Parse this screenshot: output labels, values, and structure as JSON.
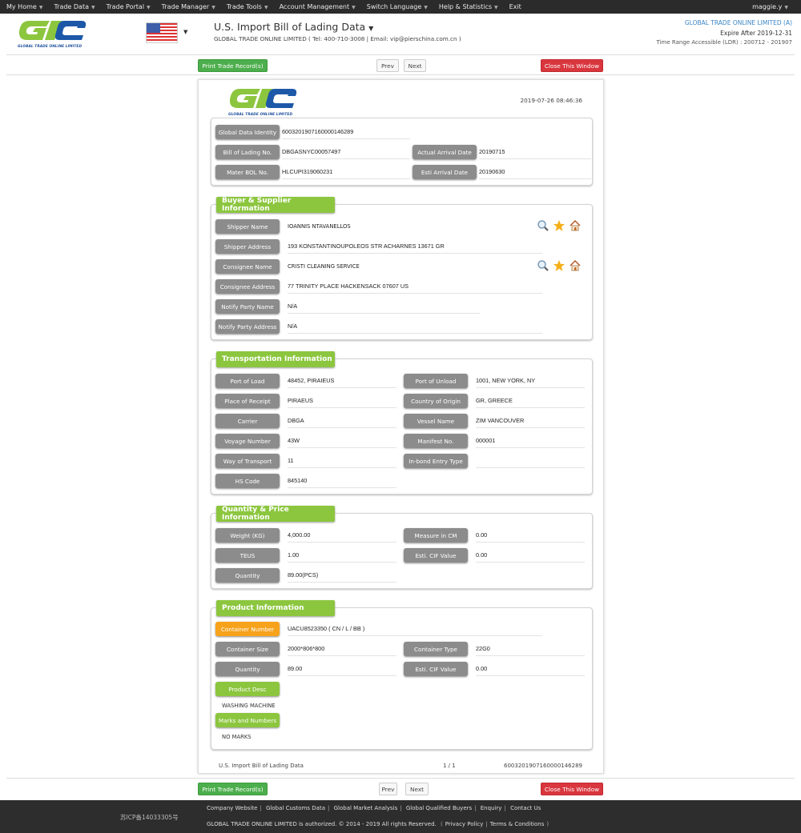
{
  "nav": {
    "items": [
      {
        "label": "My Home"
      },
      {
        "label": "Trade Data"
      },
      {
        "label": "Trade Portal"
      },
      {
        "label": "Trade Manager"
      },
      {
        "label": "Trade Tools"
      },
      {
        "label": "Account Management"
      },
      {
        "label": "Switch Language"
      },
      {
        "label": "Help & Statistics"
      }
    ],
    "exit": "Exit",
    "user": "maggie.y",
    "caret": "▼"
  },
  "header": {
    "logo_text": "GLOBAL TRADE ONLINE LIMITED",
    "title": "U.S. Import Bill of Lading Data",
    "title_caret": "▼",
    "subtitle": "GLOBAL TRADE ONLINE LIMITED ( Tel: 400-710-3008 | Email: vip@pierschina.com.cn )",
    "company": "GLOBAL TRADE ONLINE LIMITED (A)",
    "expire": "Expire After 2019-12-31",
    "time_range": "Time Range Accessible (LDR) : 200712 - 201907",
    "flag": "us-flag"
  },
  "toolbar": {
    "print": "Print Trade Record(s)",
    "prev": "Prev",
    "next": "Next",
    "close": "Close This Window"
  },
  "record": {
    "timestamp": "2019-07-26 08:46:36",
    "identity": {
      "global_data_identity_label": "Global Data Identity",
      "global_data_identity": "6003201907160000146289",
      "bol_label": "Bill of Lading No.",
      "bol": "DBGASNYC00057497",
      "actual_arrival_label": "Actual Arrival Date",
      "actual_arrival": "20190715",
      "master_bol_label": "Mater BOL No.",
      "master_bol": "HLCUPI319060231",
      "esti_arrival_label": "Esti Arrival Date",
      "esti_arrival": "20190630"
    },
    "buyer_supplier": {
      "title": "Buyer & Supplier Information",
      "shipper_name_label": "Shipper Name",
      "shipper_name": "IOANNIS NTAVANELLOS",
      "shipper_address_label": "Shipper Address",
      "shipper_address": "193 KONSTANTINOUPOLEOS STR ACHARNES 13671 GR",
      "consignee_name_label": "Consignee Name",
      "consignee_name": "CRISTI CLEANING SERVICE",
      "consignee_address_label": "Consignee Address",
      "consignee_address": "77 TRINITY PLACE HACKENSACK 07607 US",
      "notify_name_label": "Notify Party Name",
      "notify_name": "N/A",
      "notify_address_label": "Notify Party Address",
      "notify_address": "N/A"
    },
    "transport": {
      "title": "Transportation Information",
      "port_load_label": "Port of Load",
      "port_load": "48452, PIRAIEUS",
      "port_unload_label": "Port of Unload",
      "port_unload": "1001, NEW YORK, NY",
      "receipt_label": "Place of Receipt",
      "receipt": "PIRAEUS",
      "origin_label": "Country of Origin",
      "origin": "GR, GREECE",
      "carrier_label": "Carrier",
      "carrier": "DBGA",
      "vessel_label": "Vessel Name",
      "vessel": "ZIM VANCOUVER",
      "voyage_label": "Voyage Number",
      "voyage": "43W",
      "manifest_label": "Manifest No.",
      "manifest": "000001",
      "way_label": "Way of Transport",
      "way": "11",
      "inbond_label": "In-bond Entry Type",
      "inbond": "",
      "hs_label": "HS Code",
      "hs": "845140"
    },
    "quantity": {
      "title": "Quantity & Price Information",
      "weight_label": "Weight (KG)",
      "weight": "4,000.00",
      "measure_label": "Measure in CM",
      "measure": "0.00",
      "teus_label": "TEUS",
      "teus": "1.00",
      "cif_label": "Esti. CIF Value",
      "cif": "0.00",
      "qty_label": "Quantity",
      "qty": "89.00(PCS)"
    },
    "product": {
      "title": "Product Information",
      "container_number_label": "Container Number",
      "container_number": "UACU8523350 ( CN / L / BB )",
      "container_size_label": "Container Size",
      "container_size": "2000*806*800",
      "container_type_label": "Container Type",
      "container_type": "22G0",
      "qty_label": "Quantity",
      "qty": "89.00",
      "cif_label": "Esti. CIF Value",
      "cif": "0.00",
      "desc_label": "Product Desc",
      "desc": "WASHING MACHINE",
      "marks_label": "Marks and Numbers",
      "marks": "NO MARKS"
    },
    "footer": {
      "source": "U.S. Import Bill of Lading Data",
      "page": "1 / 1",
      "id": "6003201907160000146289"
    }
  },
  "footer": {
    "icp": "苏ICP备14033305号",
    "links": [
      "Company Website",
      "Global Customs Data",
      "Global Market Analysis",
      "Global Qualified Buyers",
      "Enquiry",
      "Contact Us"
    ],
    "copyright": "GLOBAL TRADE ONLINE LIMITED is authorized. © 2014 - 2019 All rights Reserved.",
    "privacy": "Privacy Policy",
    "terms": "Terms & Conditions"
  },
  "colors": {
    "brand_green": "#8cc63f",
    "brand_blue": "#1d58a8",
    "button_green": "#4cae4c",
    "button_red": "#d9363e",
    "label_gray": "#8c8c8c",
    "label_orange": "#f7a21b"
  }
}
